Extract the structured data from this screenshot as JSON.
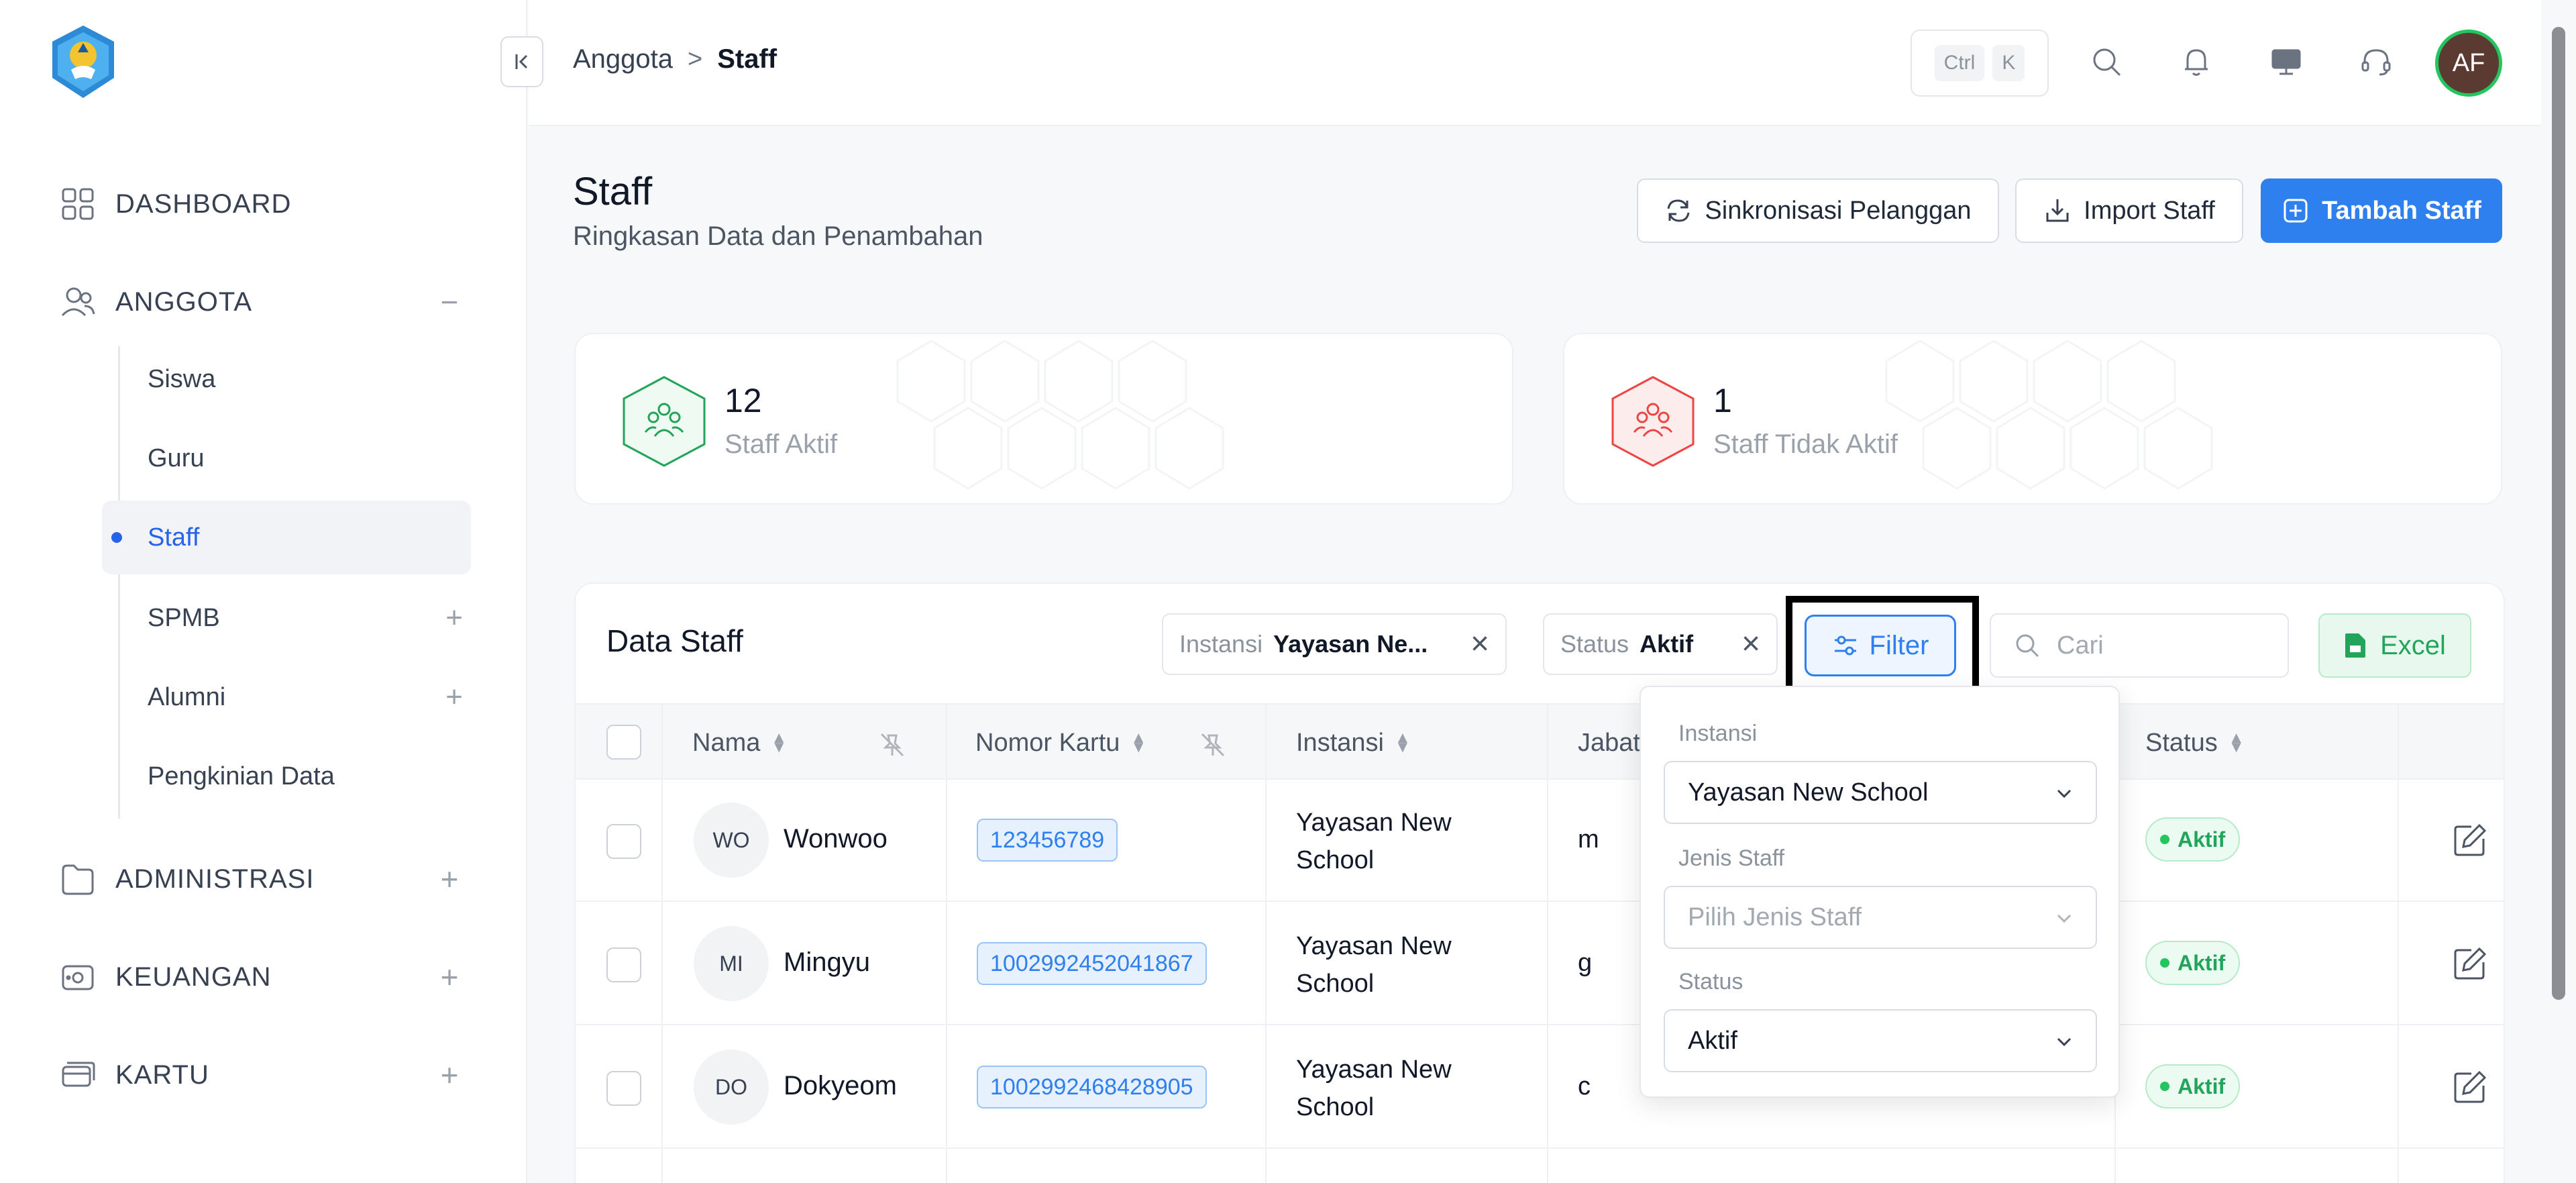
{
  "sidebar": {
    "logo_alt": "logo",
    "items": [
      {
        "label": "DASHBOARD",
        "icon": "grid-icon"
      },
      {
        "label": "ANGGOTA",
        "icon": "users-icon",
        "toggle": "−"
      },
      {
        "label": "ADMINISTRASI",
        "icon": "folder-icon",
        "toggle": "+"
      },
      {
        "label": "KEUANGAN",
        "icon": "wallet-icon",
        "toggle": "+"
      },
      {
        "label": "KARTU",
        "icon": "card-icon",
        "toggle": "+"
      }
    ],
    "sub_items": [
      {
        "label": "Siswa"
      },
      {
        "label": "Guru"
      },
      {
        "label": "Staff"
      },
      {
        "label": "SPMB",
        "toggle": "+"
      },
      {
        "label": "Alumni",
        "toggle": "+"
      },
      {
        "label": "Pengkinian Data"
      }
    ]
  },
  "topbar": {
    "breadcrumb": [
      "Anggota",
      "Staff"
    ],
    "breadcrumb_sep": ">",
    "kbd": [
      "Ctrl",
      "K"
    ],
    "avatar": "AF"
  },
  "header": {
    "title": "Staff",
    "subtitle": "Ringkasan Data dan Penambahan",
    "sync_label": "Sinkronisasi Pelanggan",
    "import_label": "Import Staff",
    "add_label": "Tambah Staff"
  },
  "stats": [
    {
      "value": "12",
      "label": "Staff Aktif",
      "color": "#22a55a"
    },
    {
      "value": "1",
      "label": "Staff Tidak Aktif",
      "color": "#ef4444"
    }
  ],
  "table": {
    "title": "Data Staff",
    "chips": [
      {
        "key": "Instansi",
        "value": "Yayasan Ne..."
      },
      {
        "key": "Status",
        "value": "Aktif"
      }
    ],
    "filter_label": "Filter",
    "search_placeholder": "Cari",
    "excel_label": "Excel",
    "columns": [
      "Nama",
      "Nomor Kartu",
      "Instansi",
      "Jabat",
      "Status"
    ],
    "rows": [
      {
        "initials": "WO",
        "name": "Wonwoo",
        "card": "123456789",
        "inst_1": "Yayasan New",
        "inst_2": "School",
        "jabatan": "m",
        "status": "Aktif"
      },
      {
        "initials": "MI",
        "name": "Mingyu",
        "card": "1002992452041867",
        "inst_1": "Yayasan New",
        "inst_2": "School",
        "jabatan": "g",
        "status": "Aktif"
      },
      {
        "initials": "DO",
        "name": "Dokyeom",
        "card": "1002992468428905",
        "inst_1": "Yayasan New",
        "inst_2": "School",
        "jabatan": "c",
        "status": "Aktif"
      }
    ]
  },
  "filter_panel": {
    "instansi_label": "Instansi",
    "instansi_value": "Yayasan New School",
    "jenis_label": "Jenis Staff",
    "jenis_placeholder": "Pilih Jenis Staff",
    "status_label": "Status",
    "status_value": "Aktif"
  },
  "colors": {
    "primary": "#2e80ee",
    "success": "#22a55a",
    "danger": "#ef4444"
  }
}
